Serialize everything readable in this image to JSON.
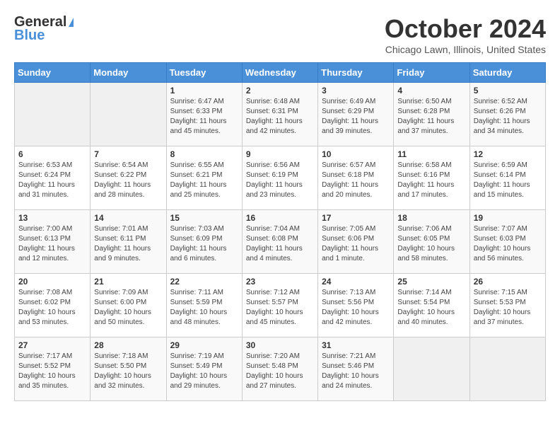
{
  "header": {
    "logo_line1": "General",
    "logo_line2": "Blue",
    "month": "October 2024",
    "location": "Chicago Lawn, Illinois, United States"
  },
  "days_of_week": [
    "Sunday",
    "Monday",
    "Tuesday",
    "Wednesday",
    "Thursday",
    "Friday",
    "Saturday"
  ],
  "weeks": [
    [
      {
        "day": "",
        "sunrise": "",
        "sunset": "",
        "daylight": ""
      },
      {
        "day": "",
        "sunrise": "",
        "sunset": "",
        "daylight": ""
      },
      {
        "day": "1",
        "sunrise": "Sunrise: 6:47 AM",
        "sunset": "Sunset: 6:33 PM",
        "daylight": "Daylight: 11 hours and 45 minutes."
      },
      {
        "day": "2",
        "sunrise": "Sunrise: 6:48 AM",
        "sunset": "Sunset: 6:31 PM",
        "daylight": "Daylight: 11 hours and 42 minutes."
      },
      {
        "day": "3",
        "sunrise": "Sunrise: 6:49 AM",
        "sunset": "Sunset: 6:29 PM",
        "daylight": "Daylight: 11 hours and 39 minutes."
      },
      {
        "day": "4",
        "sunrise": "Sunrise: 6:50 AM",
        "sunset": "Sunset: 6:28 PM",
        "daylight": "Daylight: 11 hours and 37 minutes."
      },
      {
        "day": "5",
        "sunrise": "Sunrise: 6:52 AM",
        "sunset": "Sunset: 6:26 PM",
        "daylight": "Daylight: 11 hours and 34 minutes."
      }
    ],
    [
      {
        "day": "6",
        "sunrise": "Sunrise: 6:53 AM",
        "sunset": "Sunset: 6:24 PM",
        "daylight": "Daylight: 11 hours and 31 minutes."
      },
      {
        "day": "7",
        "sunrise": "Sunrise: 6:54 AM",
        "sunset": "Sunset: 6:22 PM",
        "daylight": "Daylight: 11 hours and 28 minutes."
      },
      {
        "day": "8",
        "sunrise": "Sunrise: 6:55 AM",
        "sunset": "Sunset: 6:21 PM",
        "daylight": "Daylight: 11 hours and 25 minutes."
      },
      {
        "day": "9",
        "sunrise": "Sunrise: 6:56 AM",
        "sunset": "Sunset: 6:19 PM",
        "daylight": "Daylight: 11 hours and 23 minutes."
      },
      {
        "day": "10",
        "sunrise": "Sunrise: 6:57 AM",
        "sunset": "Sunset: 6:18 PM",
        "daylight": "Daylight: 11 hours and 20 minutes."
      },
      {
        "day": "11",
        "sunrise": "Sunrise: 6:58 AM",
        "sunset": "Sunset: 6:16 PM",
        "daylight": "Daylight: 11 hours and 17 minutes."
      },
      {
        "day": "12",
        "sunrise": "Sunrise: 6:59 AM",
        "sunset": "Sunset: 6:14 PM",
        "daylight": "Daylight: 11 hours and 15 minutes."
      }
    ],
    [
      {
        "day": "13",
        "sunrise": "Sunrise: 7:00 AM",
        "sunset": "Sunset: 6:13 PM",
        "daylight": "Daylight: 11 hours and 12 minutes."
      },
      {
        "day": "14",
        "sunrise": "Sunrise: 7:01 AM",
        "sunset": "Sunset: 6:11 PM",
        "daylight": "Daylight: 11 hours and 9 minutes."
      },
      {
        "day": "15",
        "sunrise": "Sunrise: 7:03 AM",
        "sunset": "Sunset: 6:09 PM",
        "daylight": "Daylight: 11 hours and 6 minutes."
      },
      {
        "day": "16",
        "sunrise": "Sunrise: 7:04 AM",
        "sunset": "Sunset: 6:08 PM",
        "daylight": "Daylight: 11 hours and 4 minutes."
      },
      {
        "day": "17",
        "sunrise": "Sunrise: 7:05 AM",
        "sunset": "Sunset: 6:06 PM",
        "daylight": "Daylight: 11 hours and 1 minute."
      },
      {
        "day": "18",
        "sunrise": "Sunrise: 7:06 AM",
        "sunset": "Sunset: 6:05 PM",
        "daylight": "Daylight: 10 hours and 58 minutes."
      },
      {
        "day": "19",
        "sunrise": "Sunrise: 7:07 AM",
        "sunset": "Sunset: 6:03 PM",
        "daylight": "Daylight: 10 hours and 56 minutes."
      }
    ],
    [
      {
        "day": "20",
        "sunrise": "Sunrise: 7:08 AM",
        "sunset": "Sunset: 6:02 PM",
        "daylight": "Daylight: 10 hours and 53 minutes."
      },
      {
        "day": "21",
        "sunrise": "Sunrise: 7:09 AM",
        "sunset": "Sunset: 6:00 PM",
        "daylight": "Daylight: 10 hours and 50 minutes."
      },
      {
        "day": "22",
        "sunrise": "Sunrise: 7:11 AM",
        "sunset": "Sunset: 5:59 PM",
        "daylight": "Daylight: 10 hours and 48 minutes."
      },
      {
        "day": "23",
        "sunrise": "Sunrise: 7:12 AM",
        "sunset": "Sunset: 5:57 PM",
        "daylight": "Daylight: 10 hours and 45 minutes."
      },
      {
        "day": "24",
        "sunrise": "Sunrise: 7:13 AM",
        "sunset": "Sunset: 5:56 PM",
        "daylight": "Daylight: 10 hours and 42 minutes."
      },
      {
        "day": "25",
        "sunrise": "Sunrise: 7:14 AM",
        "sunset": "Sunset: 5:54 PM",
        "daylight": "Daylight: 10 hours and 40 minutes."
      },
      {
        "day": "26",
        "sunrise": "Sunrise: 7:15 AM",
        "sunset": "Sunset: 5:53 PM",
        "daylight": "Daylight: 10 hours and 37 minutes."
      }
    ],
    [
      {
        "day": "27",
        "sunrise": "Sunrise: 7:17 AM",
        "sunset": "Sunset: 5:52 PM",
        "daylight": "Daylight: 10 hours and 35 minutes."
      },
      {
        "day": "28",
        "sunrise": "Sunrise: 7:18 AM",
        "sunset": "Sunset: 5:50 PM",
        "daylight": "Daylight: 10 hours and 32 minutes."
      },
      {
        "day": "29",
        "sunrise": "Sunrise: 7:19 AM",
        "sunset": "Sunset: 5:49 PM",
        "daylight": "Daylight: 10 hours and 29 minutes."
      },
      {
        "day": "30",
        "sunrise": "Sunrise: 7:20 AM",
        "sunset": "Sunset: 5:48 PM",
        "daylight": "Daylight: 10 hours and 27 minutes."
      },
      {
        "day": "31",
        "sunrise": "Sunrise: 7:21 AM",
        "sunset": "Sunset: 5:46 PM",
        "daylight": "Daylight: 10 hours and 24 minutes."
      },
      {
        "day": "",
        "sunrise": "",
        "sunset": "",
        "daylight": ""
      },
      {
        "day": "",
        "sunrise": "",
        "sunset": "",
        "daylight": ""
      }
    ]
  ]
}
